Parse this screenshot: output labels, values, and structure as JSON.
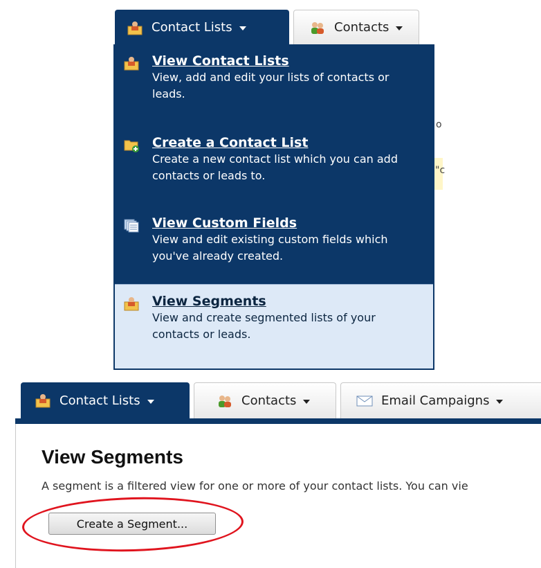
{
  "top_tabs": [
    {
      "label": "Contact Lists",
      "icon": "contact-list-icon",
      "active": true
    },
    {
      "label": "Contacts",
      "icon": "contacts-icon",
      "active": false
    }
  ],
  "menu": [
    {
      "title": "View Contact Lists",
      "desc": "View, add and edit your lists of contacts or leads.",
      "icon": "contact-list-icon"
    },
    {
      "title": "Create a Contact List",
      "desc": "Create a new contact list which you can add contacts or leads to.",
      "icon": "folder-add-icon"
    },
    {
      "title": "View Custom Fields",
      "desc": "View and edit existing custom fields which you've already created.",
      "icon": "custom-fields-icon"
    },
    {
      "title": "View Segments",
      "desc": "View and create segmented lists of your contacts or leads.",
      "icon": "segments-icon",
      "highlighted": true
    }
  ],
  "peek": {
    "char1": "o",
    "char2": "\"c"
  },
  "bottom": {
    "tabs": [
      {
        "label": "Contact Lists",
        "icon": "contact-list-icon",
        "active": true
      },
      {
        "label": "Contacts",
        "icon": "contacts-icon",
        "active": false
      },
      {
        "label": "Email Campaigns",
        "icon": "envelope-icon",
        "active": false
      }
    ],
    "page_title": "View Segments",
    "description": "A segment is a filtered view for one or more of your contact lists. You can vie",
    "button_label": "Create a Segment..."
  },
  "colors": {
    "nav_blue": "#0c3768",
    "highlight": "#dde9f7",
    "annotation_red": "#e0141e"
  }
}
